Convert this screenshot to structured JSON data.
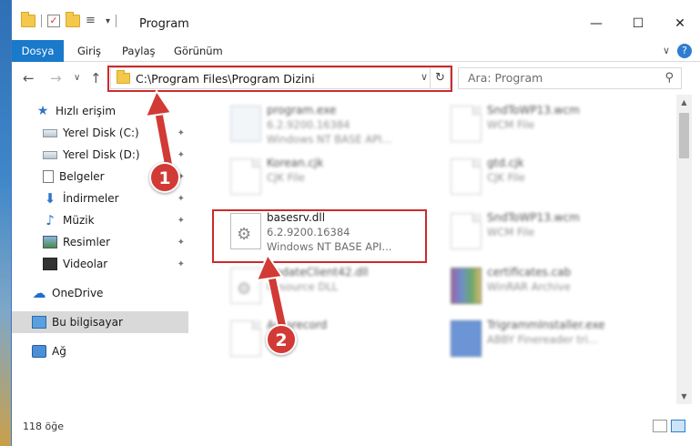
{
  "window": {
    "title": "Program",
    "qat_check_glyph": "✓",
    "qat_props_glyph": "≡",
    "qat_dropdown_glyph": "▾",
    "minimize_glyph": "—",
    "maximize_glyph": "☐",
    "close_glyph": "✕"
  },
  "ribbon": {
    "tabs": [
      "Dosya",
      "Giriş",
      "Paylaş",
      "Görünüm"
    ],
    "active_tab": "Dosya",
    "collapse_glyph": "∨",
    "help_glyph": "?"
  },
  "navigation": {
    "back_glyph": "←",
    "forward_glyph": "→",
    "recent_glyph": "∨",
    "up_glyph": "↑",
    "address_path": "C:\\Program Files\\Program Dizini",
    "address_dropdown_glyph": "∨",
    "refresh_glyph": "↻",
    "search_placeholder": "Ara: Program",
    "search_glyph": "⚲"
  },
  "sidebar": {
    "pin_glyph": "✦",
    "items": [
      {
        "label": "Hızlı erişim",
        "icon": "star-icon",
        "pinned": false
      },
      {
        "label": "Yerel Disk (C:)",
        "icon": "drive-icon",
        "pinned": true
      },
      {
        "label": "Yerel Disk (D:)",
        "icon": "drive-icon",
        "pinned": true
      },
      {
        "label": "Belgeler",
        "icon": "documents-icon",
        "pinned": true
      },
      {
        "label": "İndirmeler",
        "icon": "download-icon",
        "pinned": true
      },
      {
        "label": "Müzik",
        "icon": "music-icon",
        "pinned": true
      },
      {
        "label": "Resimler",
        "icon": "pictures-icon",
        "pinned": true
      },
      {
        "label": "Videolar",
        "icon": "videos-icon",
        "pinned": true
      },
      {
        "label": "OneDrive",
        "icon": "cloud-icon",
        "pinned": false
      },
      {
        "label": "Bu bilgisayar",
        "icon": "computer-icon",
        "pinned": false,
        "selected": true
      },
      {
        "label": "Ağ",
        "icon": "network-icon",
        "pinned": false
      }
    ]
  },
  "files": [
    {
      "name": "program.exe",
      "line1": "6.2.9200.16384",
      "line2": "Windows NT BASE API...",
      "icon": "exe-icon",
      "blurred": true
    },
    {
      "name": "SndToWP13.wcm",
      "line1": "WCM File",
      "line2": "",
      "icon": "file-icon",
      "blurred": true
    },
    {
      "name": "Korean.cjk",
      "line1": "CJK File",
      "line2": "",
      "icon": "file-icon",
      "blurred": true
    },
    {
      "name": "gtd.cjk",
      "line1": "CJK File",
      "line2": "",
      "icon": "file-icon",
      "blurred": true
    },
    {
      "name": "basesrv.dll",
      "line1": "6.2.9200.16384",
      "line2": "Windows NT BASE API...",
      "icon": "dll-gear-icon",
      "blurred": false
    },
    {
      "name": "SndToWP13.wcm",
      "line1": "WCM File",
      "line2": "",
      "icon": "file-icon",
      "blurred": true
    },
    {
      "name": "UpdateClient42.dll",
      "line1": "Resource DLL",
      "line2": "",
      "icon": "dll-gear-icon",
      "blurred": true
    },
    {
      "name": "certificates.cab",
      "line1": "WinRAR Archive",
      "line2": "",
      "icon": "rar-icon",
      "blurred": true
    },
    {
      "name": "Autorecord",
      "line1": "",
      "line2": "",
      "icon": "file-icon",
      "blurred": true
    },
    {
      "name": "TrigrammInstaller.exe",
      "line1": "ABBY Finereader tri...",
      "line2": "",
      "icon": "app-icon",
      "blurred": true
    }
  ],
  "gear_glyph": "⚙",
  "scroll": {
    "up_glyph": "▲",
    "down_glyph": "▼"
  },
  "status": {
    "item_count": "118 öğe"
  },
  "annotations": {
    "step1": "1",
    "step2": "2",
    "highlight_color": "#cc2b2b"
  }
}
